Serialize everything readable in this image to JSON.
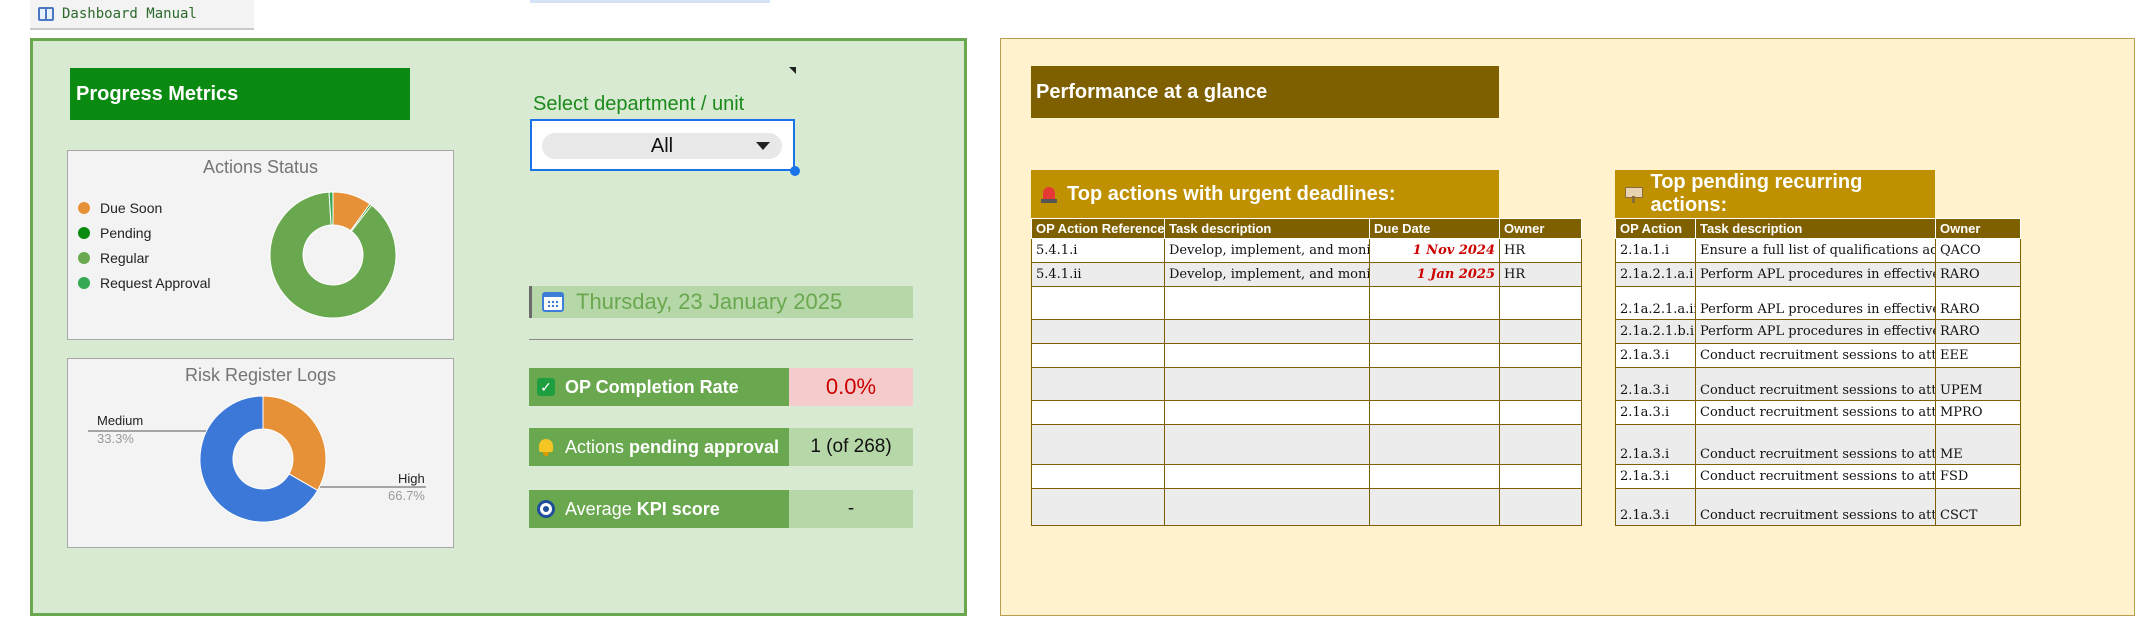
{
  "sheet_tab": {
    "label": "Dashboard Manual"
  },
  "left": {
    "title": "Progress Metrics",
    "actions_chart": {
      "title": "Actions Status",
      "legend": [
        "Due Soon",
        "Pending",
        "Regular",
        "Request Approval"
      ]
    },
    "risk_chart": {
      "title": "Risk Register Logs",
      "labels": {
        "medium": "Medium",
        "medium_pct": "33.3%",
        "high": "High",
        "high_pct": "66.7%"
      }
    },
    "department": {
      "label": "Select department / unit",
      "value": "All"
    },
    "date": "Thursday, 23 January 2025",
    "metrics": [
      {
        "label": "OP Completion Rate",
        "value": "0.0%"
      },
      {
        "label_a": "Actions ",
        "label_b": "pending approval",
        "value": "1 (of 268)"
      },
      {
        "label_a": "Average ",
        "label_b": "KPI score",
        "value": "-"
      }
    ]
  },
  "right": {
    "title": "Performance at a glance",
    "urgent": {
      "title": "Top actions with urgent deadlines:",
      "headers": [
        "OP Action Reference",
        "Task description",
        "Due Date",
        "Owner"
      ],
      "rows": [
        [
          "5.4.1.i",
          "Develop, implement, and monit",
          "1 Nov 2024",
          "HR"
        ],
        [
          "5.4.1.ii",
          "Develop, implement, and monit",
          "1 Jan 2025",
          "HR"
        ]
      ]
    },
    "recurring": {
      "title": "Top pending recurring actions:",
      "headers": [
        "OP Action",
        "Task description",
        "Owner"
      ],
      "rows": [
        [
          "2.1a.1.i",
          "Ensure a full list of qualifications add",
          "QACO"
        ],
        [
          "2.1a.2.1.a.i",
          "Perform APL procedures in effective",
          "RARO"
        ],
        [
          "2.1a.2.1.a.ii",
          "Perform APL procedures in effective",
          "RARO"
        ],
        [
          "2.1a.2.1.b.i",
          "Perform APL procedures in effective",
          "RARO"
        ],
        [
          "2.1a.3.i",
          "Conduct recruitment sessions to attr",
          "EEE"
        ],
        [
          "2.1a.3.i",
          "Conduct recruitment sessions to attr",
          "UPEM"
        ],
        [
          "2.1a.3.i",
          "Conduct recruitment sessions to attr",
          "MPRO"
        ],
        [
          "2.1a.3.i",
          "Conduct recruitment sessions to attr",
          "ME"
        ],
        [
          "2.1a.3.i",
          "Conduct recruitment sessions to attr",
          "FSD"
        ],
        [
          "2.1a.3.i",
          "Conduct recruitment sessions to attr",
          "CSCT"
        ]
      ]
    }
  },
  "chart_data": [
    {
      "type": "pie",
      "title": "Actions Status",
      "categories": [
        "Due Soon",
        "Pending",
        "Regular",
        "Request Approval"
      ],
      "values": [
        0.1,
        0.005,
        0.885,
        0.01
      ],
      "colors": [
        "#e69138",
        "#0b8a10",
        "#6aa84f",
        "#34a853"
      ],
      "donut": true,
      "legend": "left"
    },
    {
      "type": "pie",
      "title": "Risk Register Logs",
      "categories": [
        "Medium",
        "High"
      ],
      "values": [
        33.3,
        66.7
      ],
      "colors": [
        "#e69138",
        "#3c78d8"
      ],
      "donut": true
    }
  ]
}
